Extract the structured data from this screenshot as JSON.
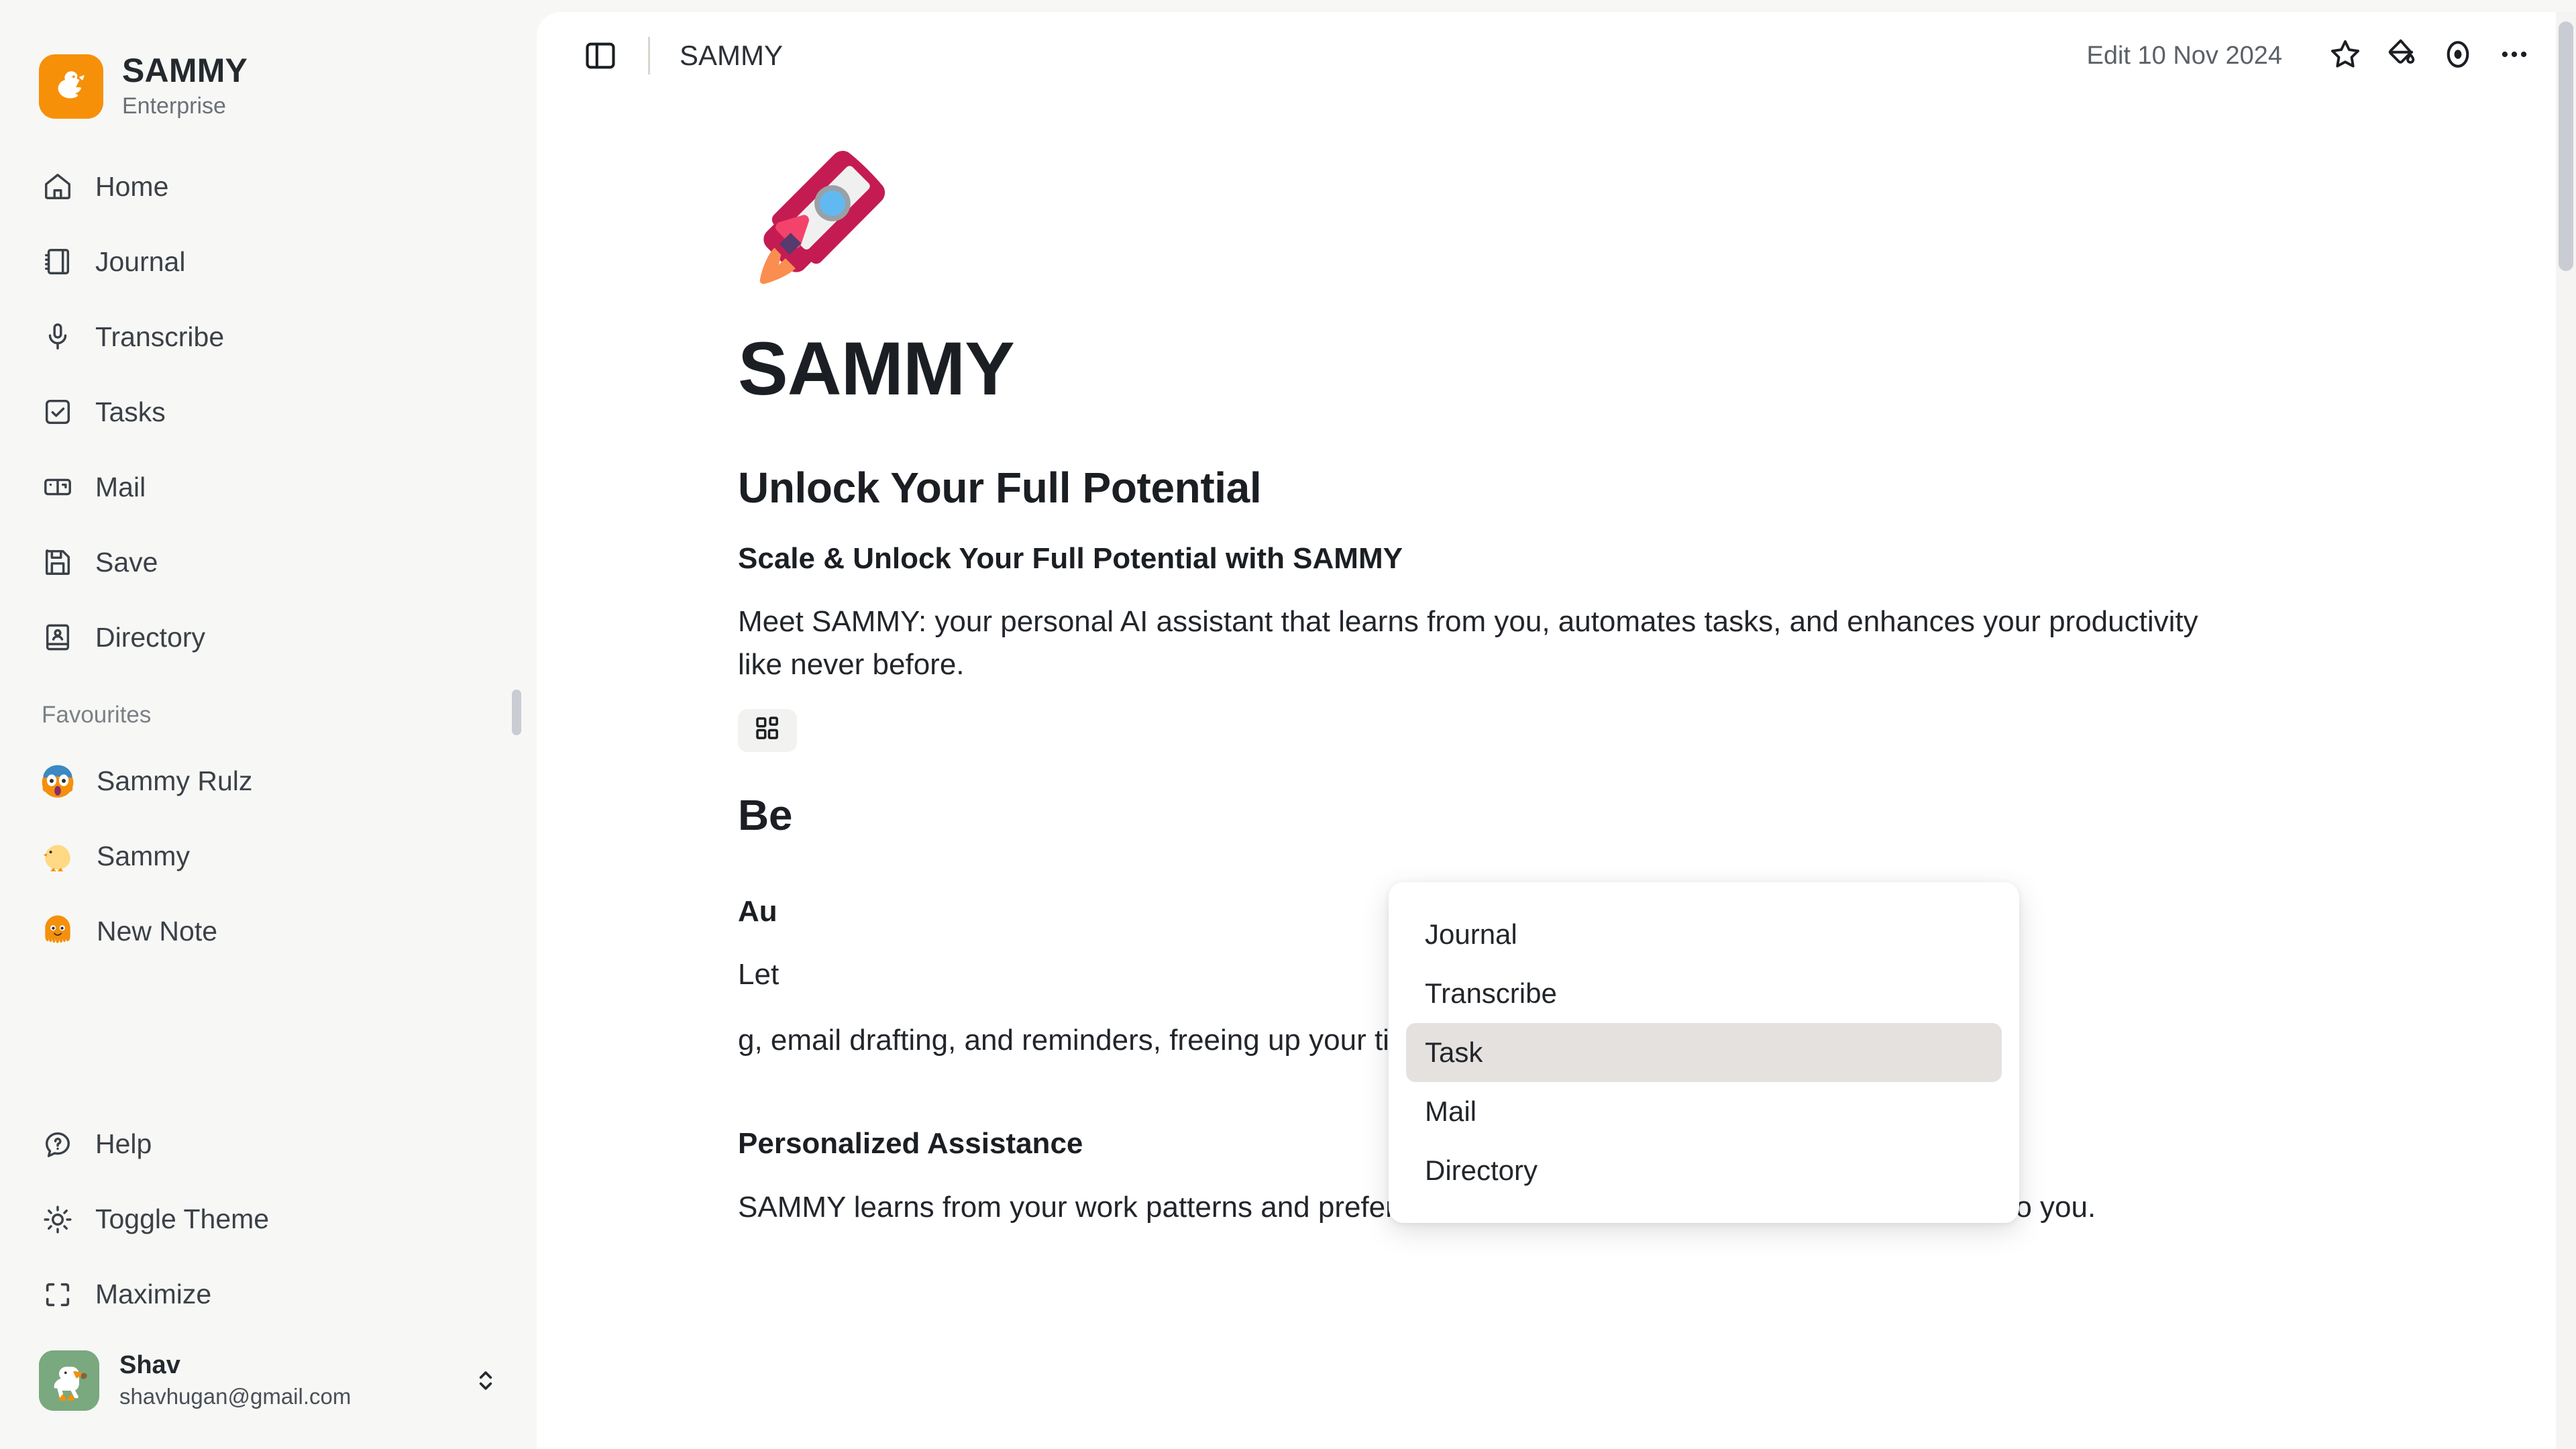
{
  "brand": {
    "name": "SAMMY",
    "plan": "Enterprise",
    "logo_icon": "duck-logo-icon",
    "logo_color": "#f79009"
  },
  "sidebar": {
    "nav": [
      {
        "label": "Home",
        "icon": "home-icon"
      },
      {
        "label": "Journal",
        "icon": "notebook-icon"
      },
      {
        "label": "Transcribe",
        "icon": "microphone-icon"
      },
      {
        "label": "Tasks",
        "icon": "checkbox-check-icon"
      },
      {
        "label": "Mail",
        "icon": "mailbox-icon"
      },
      {
        "label": "Save",
        "icon": "floppy-disk-icon"
      },
      {
        "label": "Directory",
        "icon": "contact-book-icon"
      }
    ],
    "favourites_heading": "Favourites",
    "favourites": [
      {
        "label": "Sammy Rulz",
        "icon": "face-screaming-emoji"
      },
      {
        "label": "Sammy",
        "icon": "baby-chick-emoji"
      },
      {
        "label": "New Note",
        "icon": "octopus-emoji"
      }
    ],
    "utility": [
      {
        "label": "Help",
        "icon": "help-chat-icon"
      },
      {
        "label": "Toggle Theme",
        "icon": "sun-icon"
      },
      {
        "label": "Maximize",
        "icon": "maximize-icon"
      }
    ],
    "user": {
      "name": "Shav",
      "email": "shavhugan@gmail.com",
      "avatar_icon": "goose-avatar",
      "avatar_color": "#7aa87f",
      "chevron_icon": "chevron-up-down-icon"
    }
  },
  "topbar": {
    "panel_toggle_icon": "sidebar-panel-toggle-icon",
    "document_title": "SAMMY",
    "edit_date": "Edit 10 Nov 2024",
    "actions": [
      {
        "name": "favourite",
        "icon": "star-icon"
      },
      {
        "name": "theme-color",
        "icon": "paint-bucket-icon"
      },
      {
        "name": "preview",
        "icon": "eye-icon"
      },
      {
        "name": "more",
        "icon": "ellipsis-icon"
      }
    ]
  },
  "document": {
    "cover_emoji": "rocket-emoji",
    "title": "SAMMY",
    "section_1_heading": "Unlock Your Full Potential",
    "section_1_subheading": "Scale & Unlock Your Full Potential with SAMMY",
    "section_1_paragraph": "Meet SAMMY: your personal AI assistant that learns from you, automates tasks, and enhances your productivity like never before.",
    "widget_button_icon": "blocks-widget-icon",
    "section_2_heading": "Be",
    "section_3_heading": "Au",
    "section_3_paragraph_start": "Let",
    "section_3_paragraph_end": "g, email drafting, and reminders, freeing up your time for more important work.",
    "section_4_heading": "Personalized Assistance",
    "section_4_paragraph": "SAMMY learns from your work patterns and preferences to provide personalized support tailored to you."
  },
  "dropdown": {
    "items": [
      {
        "label": "Journal",
        "active": false
      },
      {
        "label": "Transcribe",
        "active": false
      },
      {
        "label": "Task",
        "active": true
      },
      {
        "label": "Mail",
        "active": false
      },
      {
        "label": "Directory",
        "active": false
      }
    ]
  },
  "colors": {
    "accent": "#f79009",
    "app_background": "#f7f7f6",
    "panel_background": "#ffffff",
    "text_primary": "#1b1f23",
    "text_muted": "#6b7077",
    "dropdown_active": "#e5e1de",
    "scrollbar_thumb": "#c9ccd3"
  }
}
